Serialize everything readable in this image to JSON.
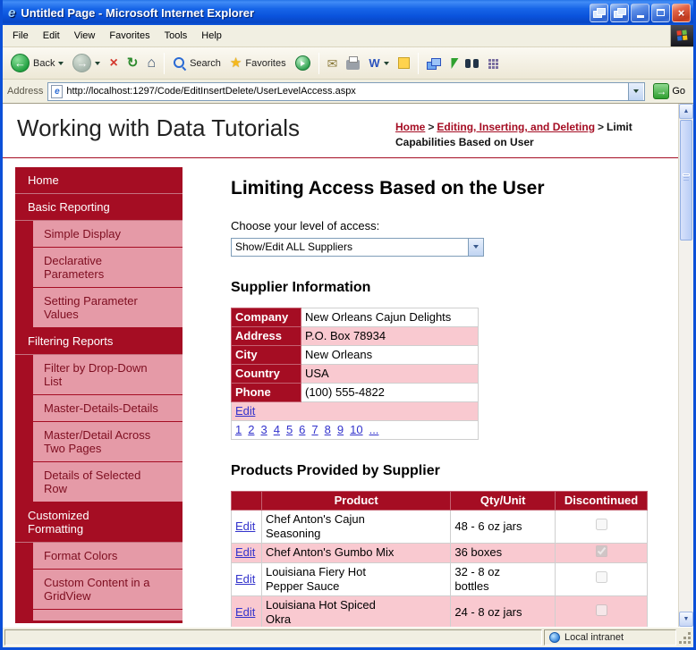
{
  "window": {
    "title": "Untitled Page - Microsoft Internet Explorer",
    "status_right": "Local intranet"
  },
  "menubar": {
    "items": [
      "File",
      "Edit",
      "View",
      "Favorites",
      "Tools",
      "Help"
    ]
  },
  "toolbar": {
    "back": "Back",
    "search": "Search",
    "favorites": "Favorites"
  },
  "addressbar": {
    "label": "Address",
    "url": "http://localhost:1297/Code/EditInsertDelete/UserLevelAccess.aspx",
    "go": "Go"
  },
  "header": {
    "site_title": "Working with Data Tutorials",
    "breadcrumb": {
      "home": "Home",
      "sep1": ">",
      "section": "Editing, Inserting, and Deleting",
      "sep2": ">",
      "current": "Limit Capabilities Based on User"
    }
  },
  "sidebar": {
    "items": [
      {
        "label": "Home",
        "level": "top"
      },
      {
        "label": "Basic Reporting",
        "level": "top"
      },
      {
        "label": "Simple Display",
        "level": "sub"
      },
      {
        "label": "Declarative Parameters",
        "level": "sub"
      },
      {
        "label": "Setting Parameter Values",
        "level": "sub"
      },
      {
        "label": "Filtering Reports",
        "level": "top"
      },
      {
        "label": "Filter by Drop-Down List",
        "level": "sub"
      },
      {
        "label": "Master-Details-Details",
        "level": "sub"
      },
      {
        "label": "Master/Detail Across Two Pages",
        "level": "sub"
      },
      {
        "label": "Details of Selected Row",
        "level": "sub"
      },
      {
        "label": "Customized Formatting",
        "level": "top"
      },
      {
        "label": "Format Colors",
        "level": "sub"
      },
      {
        "label": "Custom Content in a GridView",
        "level": "sub"
      }
    ]
  },
  "main": {
    "title": "Limiting Access Based on the User",
    "access_label": "Choose your level of access:",
    "access_selected": "Show/Edit ALL Suppliers",
    "supplier_heading": "Supplier Information",
    "supplier": {
      "fields": [
        {
          "name": "Company",
          "value": "New Orleans Cajun Delights"
        },
        {
          "name": "Address",
          "value": "P.O. Box 78934"
        },
        {
          "name": "City",
          "value": "New Orleans"
        },
        {
          "name": "Country",
          "value": "USA"
        },
        {
          "name": "Phone",
          "value": "(100) 555-4822"
        }
      ],
      "edit": "Edit",
      "pager": [
        "1",
        "2",
        "3",
        "4",
        "5",
        "6",
        "7",
        "8",
        "9",
        "10",
        "..."
      ]
    },
    "products_heading": "Products Provided by Supplier",
    "products": {
      "headers": {
        "product": "Product",
        "qty": "Qty/Unit",
        "discontinued": "Discontinued"
      },
      "edit": "Edit",
      "rows": [
        {
          "product": "Chef Anton's Cajun Seasoning",
          "qty": "48 - 6 oz jars",
          "discontinued": false
        },
        {
          "product": "Chef Anton's Gumbo Mix",
          "qty": "36 boxes",
          "discontinued": true
        },
        {
          "product": "Louisiana Fiery Hot Pepper Sauce",
          "qty": "32 - 8 oz bottles",
          "discontinued": false
        },
        {
          "product": "Louisiana Hot Spiced Okra",
          "qty": "24 - 8 oz jars",
          "discontinued": false
        }
      ]
    }
  },
  "icons": {
    "ie_logo": "e",
    "back_arrow": "←",
    "forward_arrow": "→",
    "stop": "×",
    "refresh": "↻",
    "home": "⌂",
    "favorites_star": "★",
    "mail": "✉",
    "edit_w": "W",
    "close": "×",
    "go_arrow": "→",
    "scroll_up": "▲",
    "scroll_down": "▼"
  },
  "colors": {
    "maroon": "#A50D23",
    "sidebar_pink": "#E59AA7",
    "row_pink": "#F9C9D0",
    "link_blue": "#3333CC",
    "titlebar_blue": "#0B50D8"
  }
}
